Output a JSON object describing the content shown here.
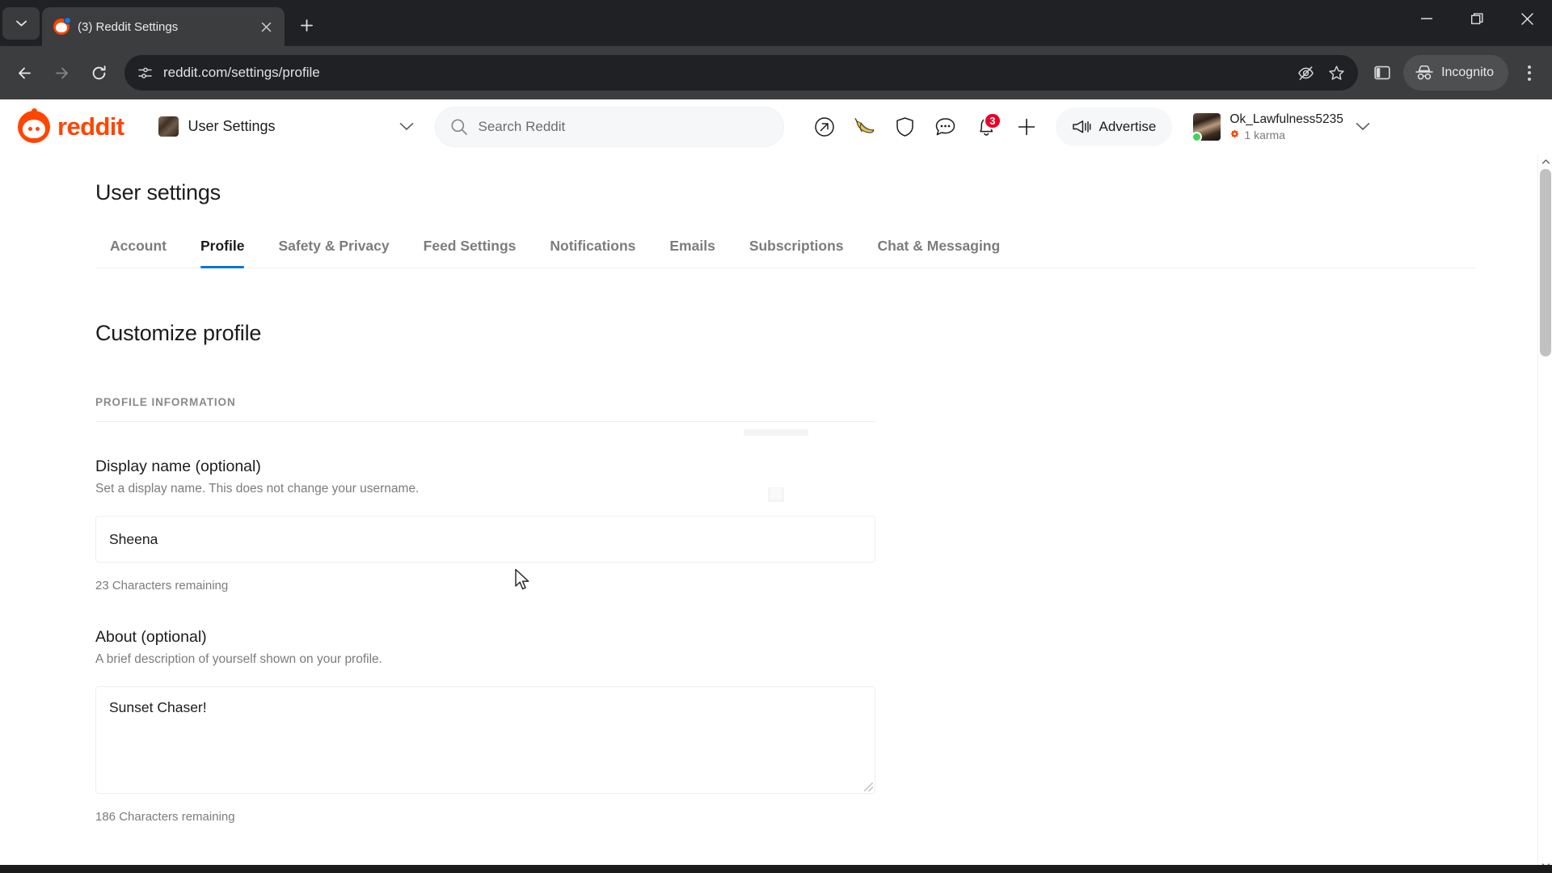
{
  "browser": {
    "tab": {
      "title": "(3) Reddit Settings",
      "favicon": "reddit-favicon",
      "close_label": "✕"
    },
    "tab_search_icon": "chevron-down-icon",
    "new_tab_icon": "plus-icon",
    "window_controls": {
      "minimize": "minimize-icon",
      "maximize": "restore-icon",
      "close": "close-icon"
    },
    "nav": {
      "back": "back-arrow-icon",
      "forward": "forward-arrow-icon",
      "reload": "reload-icon"
    },
    "omnibox": {
      "site_info_icon": "site-settings-icon",
      "url": "reddit.com/settings/profile"
    },
    "toolbar_right": {
      "tracking_protection_icon": "eye-slash-icon",
      "bookmark_icon": "star-icon",
      "side_panel_icon": "side-panel-icon",
      "incognito_label": "Incognito",
      "incognito_icon": "incognito-hat-icon",
      "menu_icon": "three-dot-menu-icon"
    }
  },
  "reddit_header": {
    "logo_text": "reddit",
    "community_picker": {
      "label": "User Settings",
      "thumb": "community-thumbnail",
      "chevron": "chevron-down-icon"
    },
    "search": {
      "placeholder": "Search Reddit",
      "icon": "search-icon"
    },
    "icons": [
      {
        "name": "popular-icon",
        "glyph": "↗"
      },
      {
        "name": "banana-icon",
        "glyph": "🍌"
      },
      {
        "name": "shield-icon",
        "glyph": "shield"
      },
      {
        "name": "chat-icon",
        "glyph": "chat"
      },
      {
        "name": "notifications-icon",
        "glyph": "bell",
        "badge": "3"
      },
      {
        "name": "create-post-icon",
        "glyph": "+"
      }
    ],
    "advertise": {
      "label": "Advertise",
      "icon": "megaphone-icon"
    },
    "user": {
      "username": "Ok_Lawfulness5235",
      "karma": "1 karma",
      "karma_icon": "karma-flower-icon",
      "status": "online",
      "chevron": "chevron-down-icon"
    }
  },
  "page": {
    "title": "User settings",
    "tabs": [
      {
        "label": "Account",
        "active": false
      },
      {
        "label": "Profile",
        "active": true
      },
      {
        "label": "Safety & Privacy",
        "active": false
      },
      {
        "label": "Feed Settings",
        "active": false
      },
      {
        "label": "Notifications",
        "active": false
      },
      {
        "label": "Emails",
        "active": false
      },
      {
        "label": "Subscriptions",
        "active": false
      },
      {
        "label": "Chat & Messaging",
        "active": false
      }
    ],
    "section_heading": "Customize profile",
    "subsection_heading": "PROFILE INFORMATION",
    "fields": [
      {
        "label": "Display name (optional)",
        "help": "Set a display name. This does not change your username.",
        "value": "Sheena",
        "placeholder": "Display name (optional)",
        "counter": "23 Characters remaining"
      },
      {
        "label": "About (optional)",
        "help": "A brief description of yourself shown on your profile.",
        "value": "Sunset Chaser!",
        "placeholder": "About (optional)",
        "counter": "186 Characters remaining"
      }
    ]
  },
  "colors": {
    "reddit_orange": "#ff4500",
    "accent_blue": "#0079d3",
    "focus_blue": "#4a90e2",
    "badge_red": "#ea0027",
    "online_green": "#46d160",
    "chrome_dark": "#202124",
    "toolbar_dark": "#3c3d3f"
  },
  "scroll": {
    "vertical_up_icon": "scroll-up-arrow",
    "vertical_down_icon": "scroll-down-arrow"
  }
}
